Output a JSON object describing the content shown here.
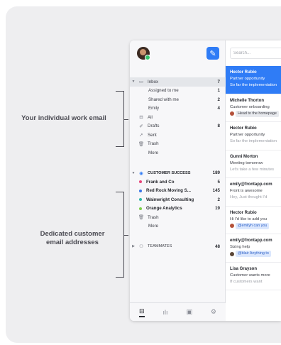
{
  "callouts": {
    "work_email": "Your individual work email",
    "customer_email_line1": "Dedicated customer",
    "customer_email_line2": "email addresses"
  },
  "colors": {
    "accent": "#2f7cf6",
    "online": "#33c46b"
  },
  "sidebar": {
    "inbox": {
      "label": "Inbox",
      "count": "7",
      "icon": "inbox-icon"
    },
    "inbox_children": [
      {
        "label": "Assigned to me",
        "count": "1"
      },
      {
        "label": "Shared with me",
        "count": "2"
      },
      {
        "label": "Emily",
        "count": "4"
      }
    ],
    "personal": [
      {
        "label": "All",
        "count": "",
        "icon": "all-icon"
      },
      {
        "label": "Drafts",
        "count": "8",
        "icon": "drafts-icon"
      },
      {
        "label": "Sent",
        "count": "",
        "icon": "sent-icon"
      },
      {
        "label": "Trash",
        "count": "",
        "icon": "trash-icon"
      },
      {
        "label": "More",
        "count": "",
        "icon": ""
      }
    ],
    "team": {
      "label": "CUSTOMER SUCCESS",
      "count": "189"
    },
    "team_inboxes": [
      {
        "label": "Frank and Co",
        "count": "5",
        "color": "#e8457a"
      },
      {
        "label": "Red Rock Moving S...",
        "count": "145",
        "color": "#3a74e8"
      },
      {
        "label": "Wainwright Consulting",
        "count": "2",
        "color": "#2bb7a6"
      },
      {
        "label": "Orange Analytics",
        "count": "19",
        "color": "#7dd04a"
      }
    ],
    "team_extra": [
      {
        "label": "Trash",
        "icon": "trash-icon"
      },
      {
        "label": "More",
        "icon": ""
      }
    ],
    "teammates": {
      "label": "TEAMMATES",
      "count": "48"
    }
  },
  "search": {
    "placeholder": "Search..."
  },
  "conversations": [
    {
      "who": "Hector Rubio",
      "subject": "Partner opportunity",
      "preview": "So far the implementation",
      "active": true
    },
    {
      "who": "Michelle Thorton",
      "subject": "Customer onboarding",
      "tag": "Head to the homepage",
      "tag_type": "tag"
    },
    {
      "who": "Hector Rubio",
      "subject": "Partner opportunity",
      "preview": "So far the implementation"
    },
    {
      "who": "Gunni Morton",
      "subject": "Meeting tomorrow",
      "preview": "Let's take a few minutes"
    },
    {
      "who": "emily@frontapp.com",
      "subject": "Front is awesome",
      "preview": "Hey, Just thought I'd"
    },
    {
      "who": "Hector Rubio",
      "subject": "Hi I'd like to add you",
      "tag": "@emilyh can you",
      "tag_type": "mention"
    },
    {
      "who": "emily@frontapp.com",
      "subject": "Sizing help",
      "tag": "@blair Anything to",
      "tag_type": "mention"
    },
    {
      "who": "Lisa Grayson",
      "subject": "Customer wants more",
      "preview": "If customers want"
    }
  ]
}
